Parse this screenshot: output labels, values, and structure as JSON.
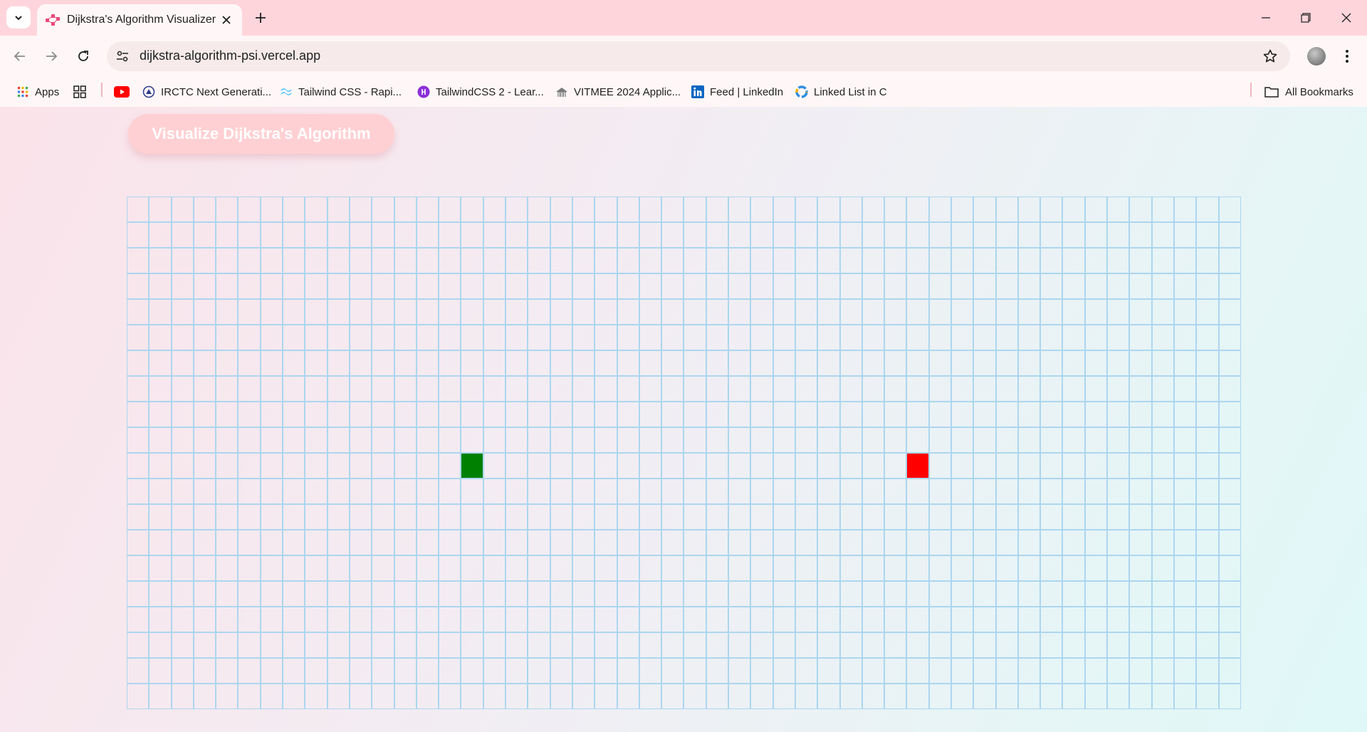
{
  "browser": {
    "tab": {
      "title": "Dijkstra's Algorithm Visualizer",
      "favicon": "graph-favicon-icon"
    },
    "url": "dijkstra-algorithm-psi.vercel.app",
    "bookmarks": [
      {
        "label": "Apps",
        "icon": "apps-grid-icon"
      },
      {
        "label": "",
        "icon": "tab-groups-icon"
      },
      {
        "label": "",
        "icon": "youtube-icon"
      },
      {
        "label": "IRCTC Next Generati...",
        "icon": "irctc-icon"
      },
      {
        "label": "Tailwind CSS - Rapi...",
        "icon": "tailwind-icon"
      },
      {
        "label": "TailwindCSS 2 - Lear...",
        "icon": "tailwind2-icon"
      },
      {
        "label": "VITMEE 2024 Applic...",
        "icon": "vitmee-icon"
      },
      {
        "label": "Feed | LinkedIn",
        "icon": "linkedin-icon"
      },
      {
        "label": "Linked List in C",
        "icon": "linked-list-icon"
      }
    ],
    "all_bookmarks_label": "All Bookmarks"
  },
  "page": {
    "visualize_button": "Visualize Dijkstra's Algorithm",
    "grid": {
      "rows": 20,
      "cols": 50,
      "start_node": {
        "row": 10,
        "col": 15,
        "color": "#008000"
      },
      "finish_node": {
        "row": 10,
        "col": 35,
        "color": "#ff0000"
      },
      "cell_border_color": "#acd6ef"
    }
  }
}
